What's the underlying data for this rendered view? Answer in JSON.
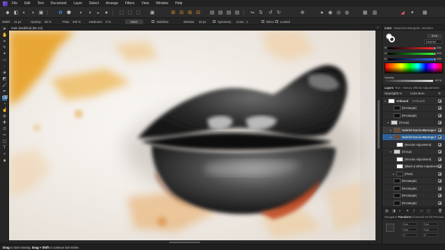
{
  "menu": [
    "File",
    "Edit",
    "Text",
    "Document",
    "Layer",
    "Select",
    "Arrange",
    "Filters",
    "View",
    "Window",
    "Help"
  ],
  "context_bar": {
    "width_label": "Width:",
    "width_value": "41 px",
    "opacity_label": "Opacity:",
    "opacity_value": "48 %",
    "flow_label": "Flow:",
    "flow_value": "100 %",
    "hardness_label": "Hardness:",
    "hardness_value": "0 %",
    "more_label": "More",
    "stabilizer_label": "Stabilizer",
    "window_label": "Window",
    "window_value": "34 px",
    "symmetry_label": "Symmetry",
    "lines_label": "Lines:",
    "lines_value": "1",
    "mirror_label": "Mirror",
    "locked_label": "Locked"
  },
  "document": {
    "tab_title": "main (Modified) [56.1%]",
    "close_glyph": "×"
  },
  "status": {
    "action": "Drag",
    "action_desc": "to start erasing.",
    "modifier": "Drag + Shift",
    "modifier_desc": "to continue last stroke."
  },
  "color_panel": {
    "tabs": [
      "Color",
      "Swatches",
      "Histogram",
      "Brushes"
    ],
    "active_tab": "Color",
    "mode": "RGB",
    "hex": "FFFFFF",
    "sliders": [
      {
        "label": "R",
        "value": "255",
        "color": "#ff4040"
      },
      {
        "label": "G",
        "value": "255",
        "color": "#40ff40"
      },
      {
        "label": "B",
        "value": "255",
        "color": "#4080ff"
      }
    ],
    "opacity_label": "Opacity",
    "opacity_value": "60 %"
  },
  "layers_panel": {
    "tabs": [
      "Layers",
      "Text",
      "History",
      "Effects",
      "Adjustments"
    ],
    "active_tab": "Layers",
    "opacity_label": "Opacity:",
    "opacity_value": "100 %",
    "blend_mode": "Color Burn",
    "layers": [
      {
        "name": "Artboard",
        "suffix": "(Artboard)",
        "indent": 0,
        "arrow": "▾",
        "thumb": "#ffffff",
        "state": "normal",
        "bold": true
      },
      {
        "name": "(Rectangle)",
        "suffix": "",
        "indent": 2,
        "arrow": "",
        "thumb": "#111111",
        "state": "normal",
        "bold": false
      },
      {
        "name": "(Rectangle)",
        "suffix": "",
        "indent": 2,
        "arrow": "",
        "thumb": "#111111",
        "state": "normal",
        "bold": false
      },
      {
        "name": "(Group)",
        "suffix": "",
        "indent": 1,
        "arrow": "▾",
        "thumb": "#d0d0d0",
        "state": "normal",
        "bold": false
      },
      {
        "name": "Gabriel-Garcia-Marengo-l",
        "suffix": "",
        "indent": 2,
        "arrow": "▸",
        "thumb": "#6a4a3a",
        "state": "highlight",
        "bold": true
      },
      {
        "name": "Gabriel-Garcia-Marengo-l",
        "suffix": "",
        "indent": 2,
        "arrow": "▾",
        "thumb": "#6a4a3a",
        "state": "selected",
        "bold": true
      },
      {
        "name": "(Recolor Adjustment)",
        "suffix": "",
        "indent": 3,
        "arrow": "",
        "thumb": "#ffffff",
        "state": "normal",
        "bold": false
      },
      {
        "name": "(Group)",
        "suffix": "",
        "indent": 2,
        "arrow": "▾",
        "thumb": "#d0d0d0",
        "state": "normal",
        "bold": false
      },
      {
        "name": "(Recolor Adjustment)",
        "suffix": "",
        "indent": 3,
        "arrow": "",
        "thumb": "#ffffff",
        "state": "normal",
        "bold": false
      },
      {
        "name": "(Black & White Adjustment)",
        "suffix": "",
        "indent": 3,
        "arrow": "",
        "thumb": "#ffffff",
        "state": "normal",
        "bold": false
      },
      {
        "name": "(Pixel)",
        "suffix": "",
        "indent": 3,
        "arrow": "▸",
        "thumb": "#222222",
        "state": "normal",
        "bold": false
      },
      {
        "name": "(Rectangle)",
        "suffix": "",
        "indent": 2,
        "arrow": "",
        "thumb": "#111111",
        "state": "normal",
        "bold": false
      },
      {
        "name": "(Rectangle)",
        "suffix": "",
        "indent": 2,
        "arrow": "",
        "thumb": "#111111",
        "state": "normal",
        "bold": false
      },
      {
        "name": "(Rectangle)",
        "suffix": "",
        "indent": 2,
        "arrow": "",
        "thumb": "#111111",
        "state": "normal",
        "bold": false
      },
      {
        "name": "(Rectangle)",
        "suffix": "",
        "indent": 2,
        "arrow": "",
        "thumb": "#111111",
        "state": "normal",
        "bold": false
      }
    ]
  },
  "bottom_tabs": [
    "Navigator",
    "Transform",
    "Channels",
    "32-bit Preview"
  ],
  "bottom_active_tab": "Transform",
  "transform_fields": [
    "0 px",
    "0 px",
    "0 px",
    "0 px",
    "0 °",
    "0 °"
  ]
}
